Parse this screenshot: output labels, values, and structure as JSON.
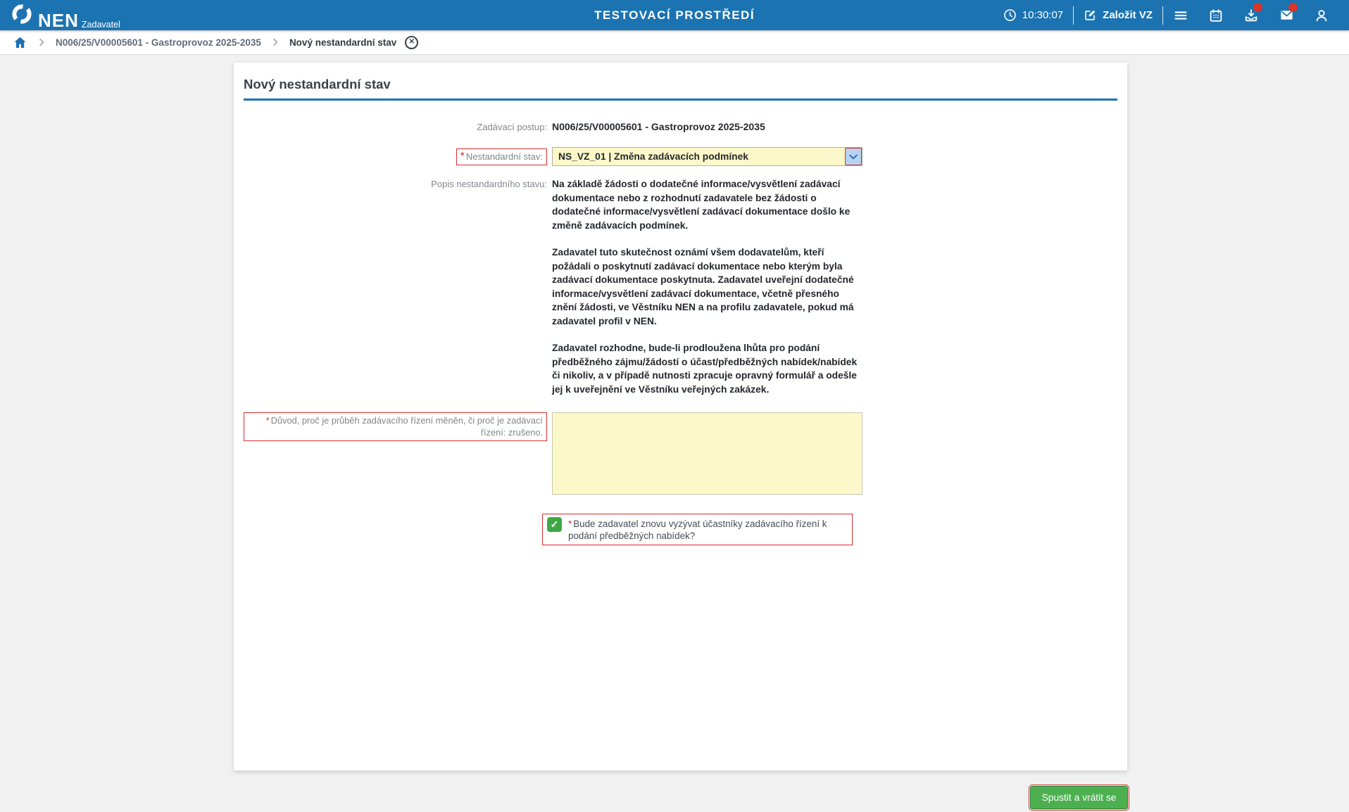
{
  "header": {
    "brand": {
      "name": "NEN",
      "role": "Zadavatel"
    },
    "environment_title": "TESTOVACÍ PROSTŘEDÍ",
    "clock_time": "10:30:07",
    "create_vz_label": "Založit VZ",
    "icons": [
      {
        "name": "menu-icon",
        "badge": false
      },
      {
        "name": "calendar-icon",
        "badge": false
      },
      {
        "name": "inbox-download-icon",
        "badge": true
      },
      {
        "name": "mail-icon",
        "badge": true
      },
      {
        "name": "user-icon",
        "badge": false
      }
    ]
  },
  "breadcrumb": {
    "items": [
      "N006/25/V00005601 - Gastroprovoz 2025-2035",
      "Nový nestandardní stav"
    ]
  },
  "page": {
    "title": "Nový nestandardní stav"
  },
  "form": {
    "required_mark": "*",
    "procedure": {
      "label": "Zadávací postup:",
      "value": "N006/25/V00005601 - Gastroprovoz 2025-2035"
    },
    "state": {
      "label": "Nestandardní stav:",
      "value": "NS_VZ_01 | Změna zadávacích podmínek"
    },
    "description": {
      "label": "Popis nestandardního stavu:",
      "paragraphs": [
        "Na základě žádosti o dodatečné informace/vysvětlení zadávací dokumentace nebo z rozhodnutí zadavatele bez žádosti o dodatečné informace/vysvětlení zadávací dokumentace došlo ke změně zadávacích podmínek.",
        "Zadavatel tuto skutečnost oznámí všem dodavatelům, kteří požádali o poskytnutí zadávací dokumentace nebo kterým byla zadávací dokumentace poskytnuta. Zadavatel uveřejní dodatečné informace/vysvětlení zadávací dokumentace, včetně přesného znění žádosti, ve Věstníku NEN a na profilu zadavatele, pokud má zadavatel profil v NEN.",
        "Zadavatel rozhodne, bude-li prodloužena lhůta pro podání předběžného zájmu/žádostí o účast/předběžných nabídek/nabídek či nikoliv, a v případě nutnosti zpracuje opravný formulář a odešle jej k uveřejnění ve Věstníku veřejných zakázek."
      ]
    },
    "reason": {
      "label": "Důvod, proč je průběh zadávacího řízení měněn, či proč je zadávací řízení: zrušeno.",
      "value": ""
    },
    "reinvite": {
      "label": "Bude zadavatel znovu vyzývat účastníky zadávacího řízení k podání předběžných nabídek?",
      "checked": true
    }
  },
  "footer": {
    "submit_label": "Spustit a vrátit se"
  },
  "colors": {
    "header_blue": "#1c73b1",
    "accent_blue": "#1a72b8",
    "highlight_yellow": "#fdf8c9",
    "required_red": "#d32f2f",
    "success_green": "#4caf50",
    "badge_red": "#d9352b"
  }
}
